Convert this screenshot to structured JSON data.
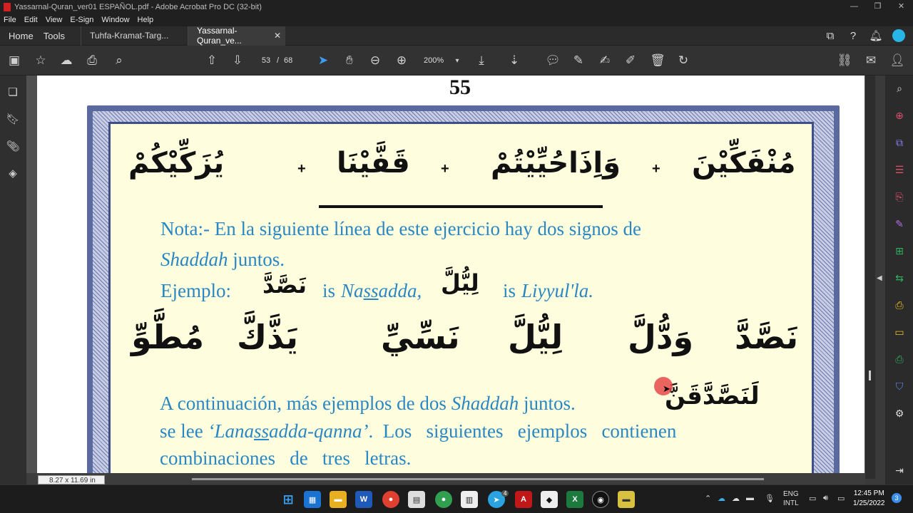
{
  "window": {
    "title": "Yassarnal-Quran_ver01 ESPAÑOL.pdf - Adobe Acrobat Pro DC (32-bit)"
  },
  "menu": [
    "File",
    "Edit",
    "View",
    "E-Sign",
    "Window",
    "Help"
  ],
  "tabs": {
    "home": "Home",
    "tools": "Tools",
    "doc1": "Tuhfa-Kramat-Targ...",
    "doc2": "Yassarnal-Quran_ve..."
  },
  "toolbar": {
    "page_current": "53",
    "page_sep": "/",
    "page_total": "68",
    "zoom": "200%"
  },
  "document": {
    "page_number": "55",
    "line1": {
      "word1": "مُنْفَكِّيْنَ",
      "word2": "وَاِذَاحُيِّيْتُمْ",
      "word3": "قَفَّيْنَا",
      "word4": "يُزَكِّيْكُمْ",
      "plus": "+"
    },
    "note": {
      "line1": "Nota:- En la siguiente línea de este ejercicio hay dos signos de",
      "line2_italic": "Shaddah",
      "line2_rest": " juntos.",
      "example_label": "Ejemplo:",
      "ex1_ar": "نَصَّدَّ",
      "ex1_is": "is",
      "ex1_tr_a": "Na",
      "ex1_tr_u": "ss",
      "ex1_tr_b": "adda,",
      "ex2_ar": "لِيُّلَّ",
      "ex2_is": "is",
      "ex2_tr": "Liyyul'la."
    },
    "line2": {
      "w1": "نَصَّدَّ",
      "w2": "وَدُّلَّ",
      "w3": "لِيُّلَّ",
      "w4": "نَسِّيِّ",
      "w5": "يَذَّكَّ",
      "w6": "مُطَّوِّ"
    },
    "continuation": {
      "l1_a": "A continuación, más ejemplos de dos ",
      "l1_italic": "Shaddah",
      "l1_b": " juntos.",
      "ar": "لَنَصَّدَّقَنَّ",
      "l2_a": "se lee ",
      "l2_italic_a": "‘Lana",
      "l2_italic_u": "ss",
      "l2_italic_b": "adda-qanna’",
      "l2_b": ".  Los   siguientes   ejemplos   contienen",
      "l3": "combinaciones   de   tres   letras."
    }
  },
  "status": {
    "page_size": "8.27 x 11.69 in"
  },
  "taskbar": {
    "lang1": "ENG",
    "lang2": "INTL",
    "time": "12:45 PM",
    "date": "1/25/2022",
    "notif_count": "3",
    "telegram_badge": "4"
  }
}
